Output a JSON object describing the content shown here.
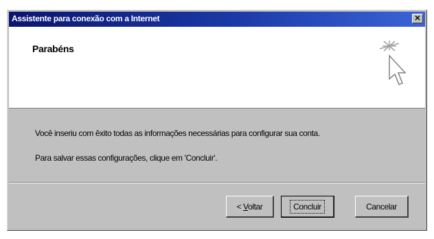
{
  "window": {
    "title": "Assistente para conexão com a Internet",
    "close_glyph": "✕"
  },
  "header": {
    "title": "Parabéns",
    "icon": "wizard-cursor-icon"
  },
  "body": {
    "line1": "Você inseriu com êxito todas as informações necessárias para configurar sua conta.",
    "line2": "Para salvar essas configurações, clique em 'Concluir'."
  },
  "buttons": {
    "back_prefix": "< ",
    "back_mnemonic": "V",
    "back_rest": "oltar",
    "finish": "Concluir",
    "cancel": "Cancelar"
  },
  "colors": {
    "titlebar_start": "#0a1570",
    "titlebar_end": "#3a64d8",
    "dialog_face": "#c0c0c0"
  }
}
